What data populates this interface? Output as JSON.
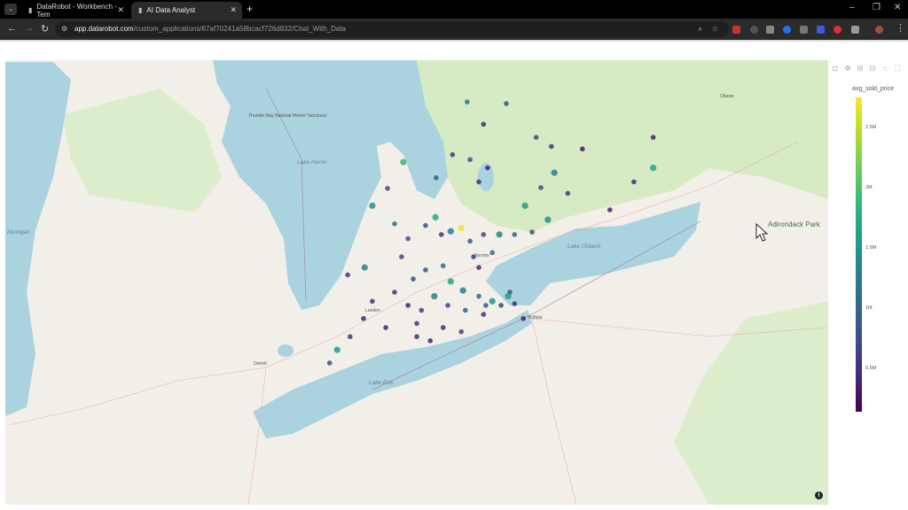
{
  "browser": {
    "tabs": [
      {
        "label": "DataRobot - Workbench - Tem",
        "active": false
      },
      {
        "label": "AI Data Analyst",
        "active": true
      }
    ],
    "url_host": "app.datarobot.com",
    "url_path": "/custom_applications/67af70241a58bcacf726d832/Chat_With_Data"
  },
  "map": {
    "labels": {
      "lake_huron": "Lake Huron",
      "lake_ontario": "Lake Ontario",
      "lake_erie": "Lake Erie",
      "michigan": "Michigan",
      "thunder_bay": "Thunder Bay National Marine Sanctuary",
      "toronto": "Toronto",
      "ottawa": "Ottawa",
      "adirondack": "Adirondack Park",
      "london": "London",
      "detroit": "Detroit",
      "buffalo": "Buffalo"
    },
    "colors": {
      "water": "#aad3df",
      "land": "#f2efe9",
      "forest": "#d6eac4"
    },
    "modebar_icons": [
      "camera-icon",
      "pan-icon",
      "zoom-in-icon",
      "zoom-out-icon",
      "home-icon",
      "autoscale-icon"
    ],
    "info_label": "i"
  },
  "chart_data": {
    "type": "scatter",
    "marker_field": "avg_sold_price",
    "colorscale": "Viridis",
    "color_range_millions": [
      0.15,
      2.76
    ],
    "colorbar": {
      "title": "avg_sold_price",
      "ticks": [
        "0.5M",
        "1M",
        "1.5M",
        "2M",
        "2.5M"
      ],
      "tick_values_millions": [
        0.5,
        1,
        1.5,
        2,
        2.5
      ]
    },
    "points_lon_lat_priceM": [
      [
        -80.82,
        44.05,
        1.1
      ],
      [
        -80.67,
        44.8,
        1.9
      ],
      [
        -80.11,
        44.61,
        1.0
      ],
      [
        -79.83,
        44.89,
        0.6
      ],
      [
        -79.53,
        44.83,
        0.8
      ],
      [
        -79.38,
        44.56,
        0.5
      ],
      [
        -79.23,
        44.73,
        0.4
      ],
      [
        -79.58,
        45.53,
        1.2
      ],
      [
        -78.91,
        45.51,
        0.9
      ],
      [
        -79.3,
        45.26,
        0.5
      ],
      [
        -78.4,
        45.1,
        0.8
      ],
      [
        -78.14,
        44.99,
        0.6
      ],
      [
        -78.09,
        44.67,
        1.3
      ],
      [
        -78.59,
        44.27,
        1.6
      ],
      [
        -78.2,
        44.1,
        1.5
      ],
      [
        -78.32,
        44.49,
        0.7
      ],
      [
        -77.86,
        44.42,
        0.6
      ],
      [
        -77.14,
        44.22,
        0.4
      ],
      [
        -76.4,
        44.73,
        1.7
      ],
      [
        -76.73,
        44.56,
        0.5
      ],
      [
        -76.4,
        45.1,
        0.4
      ],
      [
        -77.61,
        44.96,
        0.3
      ],
      [
        -81.2,
        44.27,
        1.5
      ],
      [
        -80.94,
        44.48,
        0.7
      ],
      [
        -80.12,
        44.13,
        1.7
      ],
      [
        -79.68,
        44.0,
        2.7
      ],
      [
        -79.86,
        43.96,
        1.3
      ],
      [
        -80.29,
        44.03,
        0.8
      ],
      [
        -80.02,
        43.92,
        0.6
      ],
      [
        -79.53,
        43.84,
        0.9
      ],
      [
        -79.3,
        43.92,
        0.7
      ],
      [
        -79.15,
        43.7,
        1.1
      ],
      [
        -79.03,
        43.92,
        1.3
      ],
      [
        -78.77,
        43.92,
        1.0
      ],
      [
        -78.47,
        43.95,
        0.8
      ],
      [
        -79.47,
        43.65,
        0.6
      ],
      [
        -79.38,
        43.52,
        0.5
      ],
      [
        -79.99,
        43.54,
        1.1
      ],
      [
        -80.29,
        43.49,
        0.9
      ],
      [
        -80.7,
        43.65,
        0.7
      ],
      [
        -80.5,
        43.38,
        0.8
      ],
      [
        -79.86,
        43.35,
        1.7
      ],
      [
        -79.65,
        43.24,
        1.3
      ],
      [
        -79.38,
        43.17,
        1.0
      ],
      [
        -79.15,
        43.11,
        1.5
      ],
      [
        -79.0,
        43.06,
        0.7
      ],
      [
        -78.85,
        43.22,
        0.8
      ],
      [
        -78.77,
        43.08,
        0.6
      ],
      [
        -79.3,
        42.95,
        0.5
      ],
      [
        -79.61,
        43.0,
        0.9
      ],
      [
        -79.91,
        43.06,
        0.7
      ],
      [
        -80.14,
        43.17,
        1.3
      ],
      [
        -80.36,
        43.0,
        0.6
      ],
      [
        -80.59,
        43.06,
        0.4
      ],
      [
        -80.82,
        43.22,
        0.5
      ],
      [
        -81.2,
        43.11,
        0.6
      ],
      [
        -80.97,
        42.79,
        0.5
      ],
      [
        -81.35,
        42.9,
        0.4
      ],
      [
        -81.58,
        42.68,
        0.6
      ],
      [
        -81.8,
        42.52,
        1.6
      ],
      [
        -81.93,
        42.36,
        0.8
      ],
      [
        -80.44,
        42.84,
        0.6
      ],
      [
        -79.99,
        42.79,
        0.5
      ],
      [
        -79.68,
        42.74,
        0.7
      ],
      [
        -80.44,
        42.68,
        0.5
      ],
      [
        -80.21,
        42.63,
        0.4
      ],
      [
        -78.62,
        42.9,
        0.4
      ],
      [
        -81.62,
        43.43,
        0.6
      ],
      [
        -80.59,
        43.87,
        0.8
      ],
      [
        -81.33,
        43.52,
        1.3
      ],
      [
        -78.88,
        43.17,
        1.6
      ],
      [
        -79.26,
        43.06,
        0.9
      ]
    ]
  }
}
